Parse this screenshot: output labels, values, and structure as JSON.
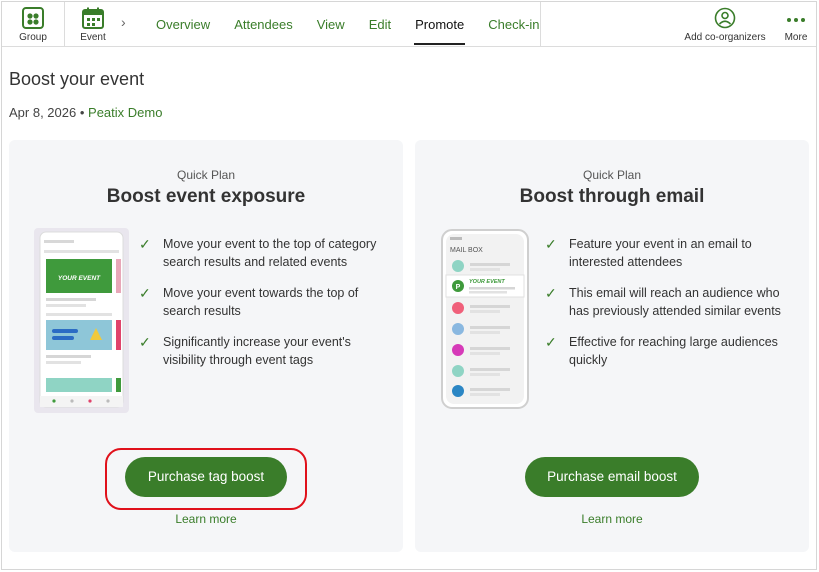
{
  "nav": {
    "group_label": "Group",
    "event_label": "Event",
    "tabs": [
      {
        "label": "Overview"
      },
      {
        "label": "Attendees"
      },
      {
        "label": "View"
      },
      {
        "label": "Edit"
      },
      {
        "label": "Promote"
      },
      {
        "label": "Check-in"
      }
    ],
    "active_tab": "Promote",
    "add_coorganizers_label": "Add co-organizers",
    "more_label": "More",
    "accent_color": "#3a7d2a"
  },
  "header": {
    "title": "Boost your event",
    "date": "Apr 8, 2026",
    "separator": "•",
    "organizer": "Peatix Demo"
  },
  "cards": [
    {
      "kicker": "Quick Plan",
      "title": "Boost event exposure",
      "illustration_text": "YOUR EVENT",
      "features": [
        "Move your event to the top of category search results and related events",
        "Move your event towards the top of search results",
        "Significantly increase your event's visibility through event tags"
      ],
      "button_label": "Purchase tag boost",
      "learn_more": "Learn more"
    },
    {
      "kicker": "Quick Plan",
      "title": "Boost through email",
      "illustration_title": "MAIL BOX",
      "illustration_text": "YOUR EVENT",
      "illustration_badge": "P",
      "features": [
        "Feature your event in an email to interested attendees",
        "This email will reach an audience who has previously attended similar events",
        "Effective for reaching large audiences quickly"
      ],
      "button_label": "Purchase email boost",
      "learn_more": "Learn more"
    }
  ],
  "annotation_color": "#e0111b"
}
